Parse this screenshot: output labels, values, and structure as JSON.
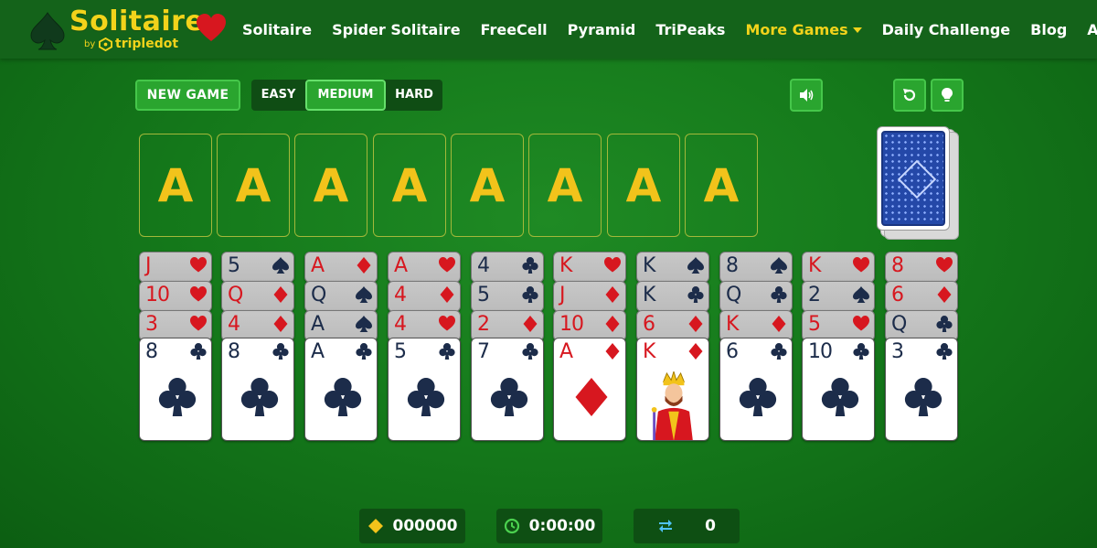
{
  "brand": {
    "title": "Solitaire",
    "by": "by",
    "company": "tripledot",
    "accent": "#f2d31b"
  },
  "nav": [
    {
      "label": "Solitaire"
    },
    {
      "label": "Spider Solitaire"
    },
    {
      "label": "FreeCell"
    },
    {
      "label": "Pyramid"
    },
    {
      "label": "TriPeaks"
    },
    {
      "label": "More Games",
      "dropdown": true
    },
    {
      "label": "Daily Challenge"
    },
    {
      "label": "Blog"
    },
    {
      "label": "About"
    }
  ],
  "controls": {
    "new_game": "NEW GAME",
    "difficulty": [
      {
        "label": "EASY",
        "selected": false
      },
      {
        "label": "MEDIUM",
        "selected": true
      },
      {
        "label": "HARD",
        "selected": false
      }
    ],
    "sound_icon": "speaker-icon",
    "undo_icon": "undo-icon",
    "hint_icon": "lightbulb-icon"
  },
  "foundations": [
    "A",
    "A",
    "A",
    "A",
    "A",
    "A",
    "A",
    "A"
  ],
  "stock": {
    "icon": "card-back"
  },
  "tableau": [
    {
      "down": [
        {
          "rank": "J",
          "suit": "hearts"
        },
        {
          "rank": "10",
          "suit": "hearts"
        },
        {
          "rank": "3",
          "suit": "hearts"
        }
      ],
      "up": {
        "rank": "8",
        "suit": "clubs"
      }
    },
    {
      "down": [
        {
          "rank": "5",
          "suit": "spades"
        },
        {
          "rank": "Q",
          "suit": "diamonds"
        },
        {
          "rank": "4",
          "suit": "diamonds"
        }
      ],
      "up": {
        "rank": "8",
        "suit": "clubs"
      }
    },
    {
      "down": [
        {
          "rank": "A",
          "suit": "diamonds"
        },
        {
          "rank": "Q",
          "suit": "spades"
        },
        {
          "rank": "A",
          "suit": "spades"
        }
      ],
      "up": {
        "rank": "A",
        "suit": "clubs"
      }
    },
    {
      "down": [
        {
          "rank": "A",
          "suit": "hearts"
        },
        {
          "rank": "4",
          "suit": "diamonds"
        },
        {
          "rank": "4",
          "suit": "hearts"
        }
      ],
      "up": {
        "rank": "5",
        "suit": "clubs"
      }
    },
    {
      "down": [
        {
          "rank": "4",
          "suit": "clubs"
        },
        {
          "rank": "5",
          "suit": "clubs"
        },
        {
          "rank": "2",
          "suit": "diamonds"
        }
      ],
      "up": {
        "rank": "7",
        "suit": "clubs"
      }
    },
    {
      "down": [
        {
          "rank": "K",
          "suit": "hearts"
        },
        {
          "rank": "J",
          "suit": "diamonds"
        },
        {
          "rank": "10",
          "suit": "diamonds"
        }
      ],
      "up": {
        "rank": "A",
        "suit": "diamonds"
      }
    },
    {
      "down": [
        {
          "rank": "K",
          "suit": "spades"
        },
        {
          "rank": "K",
          "suit": "clubs"
        },
        {
          "rank": "6",
          "suit": "diamonds"
        }
      ],
      "up": {
        "rank": "K",
        "suit": "diamonds",
        "face": true
      }
    },
    {
      "down": [
        {
          "rank": "8",
          "suit": "spades"
        },
        {
          "rank": "Q",
          "suit": "clubs"
        },
        {
          "rank": "K",
          "suit": "diamonds"
        }
      ],
      "up": {
        "rank": "6",
        "suit": "clubs"
      }
    },
    {
      "down": [
        {
          "rank": "K",
          "suit": "hearts"
        },
        {
          "rank": "2",
          "suit": "spades"
        },
        {
          "rank": "5",
          "suit": "hearts"
        }
      ],
      "up": {
        "rank": "10",
        "suit": "clubs"
      }
    },
    {
      "down": [
        {
          "rank": "8",
          "suit": "hearts"
        },
        {
          "rank": "6",
          "suit": "diamonds"
        },
        {
          "rank": "Q",
          "suit": "clubs"
        }
      ],
      "up": {
        "rank": "3",
        "suit": "clubs"
      }
    }
  ],
  "stats": {
    "score": "000000",
    "time": "0:00:00",
    "moves": "0",
    "score_icon": "diamond-icon",
    "time_icon": "clock-icon",
    "moves_icon": "swap-arrows-icon"
  }
}
